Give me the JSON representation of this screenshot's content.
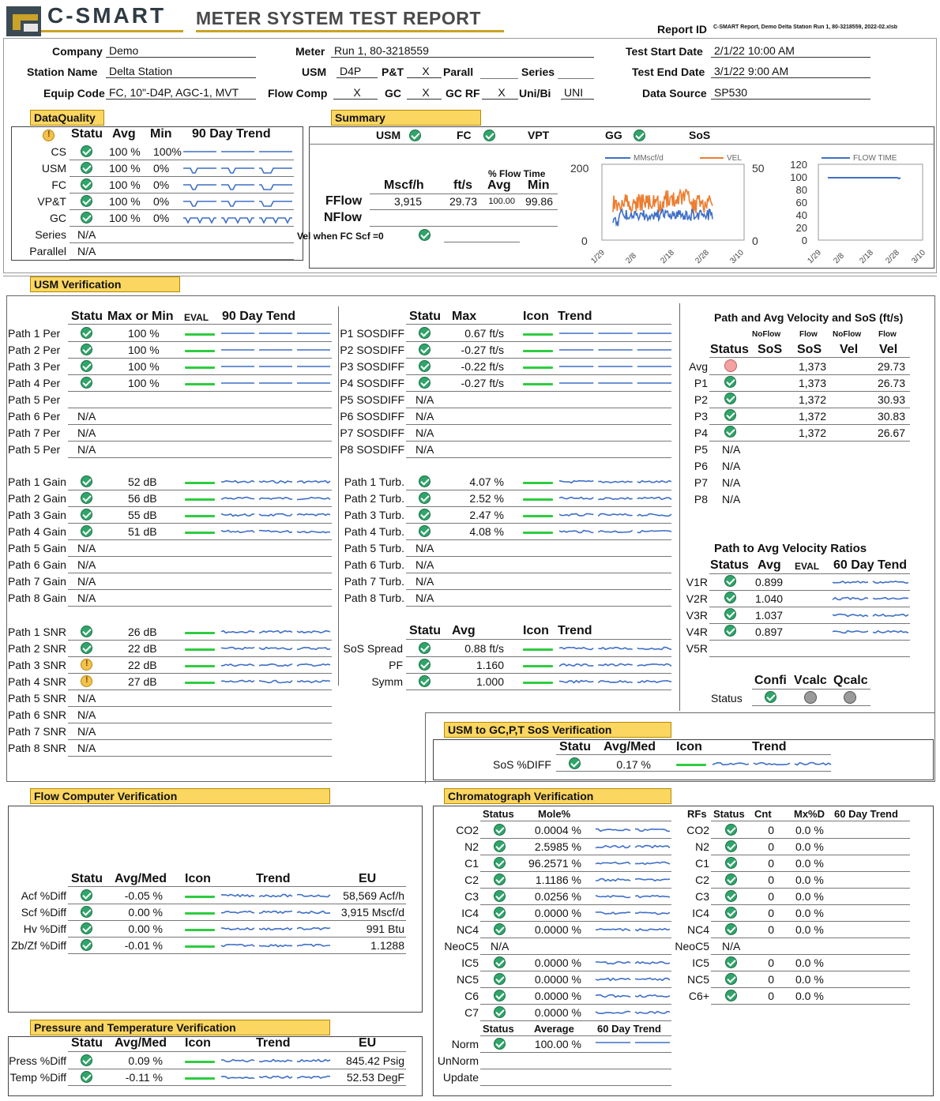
{
  "header": {
    "brand": "C-SMART",
    "title": "METER SYSTEM TEST REPORT",
    "report_id_label": "Report ID",
    "report_id_value": "C-SMART Report, Demo Delta Station Run 1, 80-3218559, 2022-02.xlsb"
  },
  "info": {
    "company_label": "Company",
    "company": "Demo",
    "station_label": "Station Name",
    "station": "Delta Station",
    "equip_label": "Equip Code",
    "equip": "FC, 10\"-D4P, AGC-1, MVT",
    "meter_label": "Meter",
    "meter": "Run 1, 80-3218559",
    "usm_label": "USM",
    "usm": "D4P",
    "pt_label": "P&T",
    "pt": "X",
    "parall_label": "Parall",
    "series_label": "Series",
    "flowcomp_label": "Flow Comp",
    "flowcomp": "X",
    "gc_label": "GC",
    "gc": "X",
    "gcrf_label": "GC RF",
    "gcrf": "X",
    "unibi_label": "Uni/Bi",
    "unibi": "UNI",
    "start_label": "Test Start Date",
    "start": "2/1/22 10:00 AM",
    "end_label": "Test End Date",
    "end": "3/1/22 9:00 AM",
    "source_label": "Data Source",
    "source": "SP530"
  },
  "dq": {
    "section": "DataQuality",
    "h_status": "Statu",
    "h_avg": "Avg",
    "h_min": "Min",
    "h_trend": "90 Day Trend",
    "rows": [
      {
        "label": "CS",
        "avg": "100 %",
        "min": "100%"
      },
      {
        "label": "USM",
        "avg": "100 %",
        "min": "0%"
      },
      {
        "label": "FC",
        "avg": "100 %",
        "min": "0%"
      },
      {
        "label": "VP&T",
        "avg": "100 %",
        "min": "0%"
      },
      {
        "label": "GC",
        "avg": "100 %",
        "min": "0%"
      },
      {
        "label": "Series",
        "avg": "N/A"
      },
      {
        "label": "Parallel",
        "avg": "N/A"
      }
    ]
  },
  "summary": {
    "section": "Summary",
    "items": [
      "USM",
      "FC",
      "VPT",
      "GG",
      "SoS"
    ],
    "h_mscfh": "Mscf/h",
    "h_fts": "ft/s",
    "h_pct_flow": "% Flow Time",
    "h_avg": "Avg",
    "h_min": "Min",
    "fflow_label": "FFlow",
    "fflow_mscfh": "3,915",
    "fflow_fts": "29.73",
    "fflow_avg": "100.00",
    "fflow_min": "99.86",
    "nflow_label": "NFlow",
    "vel_label": "Vel when FC Scf =0"
  },
  "chart1": {
    "legend_a": "MMscf/d",
    "legend_b": "VEL",
    "yleft_max": "200",
    "yleft_min": "0",
    "yright_max": "50",
    "yright_min": "0",
    "xticks": [
      "1/29",
      "2/8",
      "2/18",
      "2/28",
      "3/10"
    ],
    "color_a": "#3f6fc6",
    "color_b": "#ed7d31"
  },
  "chart2": {
    "legend": "FLOW TIME",
    "yticks": [
      "120",
      "100",
      "80",
      "60",
      "40",
      "20",
      "0"
    ],
    "xticks": [
      "1/29",
      "2/8",
      "2/18",
      "2/28",
      "3/10"
    ],
    "color": "#3f6fc6"
  },
  "usm": {
    "section": "USM Verification",
    "col1": {
      "h_status": "Statu",
      "h_max": "Max or Min",
      "h_eval": "EVAL",
      "h_trend": "90 Day Tend"
    },
    "per": [
      {
        "label": "Path 1 Per",
        "val": "100 %"
      },
      {
        "label": "Path 2 Per",
        "val": "100 %"
      },
      {
        "label": "Path 3 Per",
        "val": "100 %"
      },
      {
        "label": "Path 4 Per",
        "val": "100 %"
      },
      {
        "label": "Path 5 Per"
      },
      {
        "label": "Path 6 Per",
        "na": "N/A"
      },
      {
        "label": "Path 7 Per",
        "na": "N/A"
      },
      {
        "label": "Path 5 Per",
        "na": "N/A"
      }
    ],
    "gain": [
      {
        "label": "Path 1 Gain",
        "val": "52 dB"
      },
      {
        "label": "Path 2 Gain",
        "val": "56 dB"
      },
      {
        "label": "Path 3 Gain",
        "val": "55 dB"
      },
      {
        "label": "Path 4 Gain",
        "val": "51 dB"
      },
      {
        "label": "Path 5 Gain",
        "na": "N/A"
      },
      {
        "label": "Path 6 Gain",
        "na": "N/A"
      },
      {
        "label": "Path 7 Gain",
        "na": "N/A"
      },
      {
        "label": "Path 8 Gain",
        "na": "N/A"
      }
    ],
    "snr": [
      {
        "label": "Path 1 SNR",
        "val": "26 dB",
        "st": "ok"
      },
      {
        "label": "Path 2 SNR",
        "val": "22 dB",
        "st": "ok"
      },
      {
        "label": "Path 3 SNR",
        "val": "22 dB",
        "st": "warn"
      },
      {
        "label": "Path 4 SNR",
        "val": "27 dB",
        "st": "warn"
      },
      {
        "label": "Path 5 SNR",
        "na": "N/A"
      },
      {
        "label": "Path 6 SNR",
        "na": "N/A"
      },
      {
        "label": "Path 7 SNR",
        "na": "N/A"
      },
      {
        "label": "Path 8 SNR",
        "na": "N/A"
      }
    ],
    "col2": {
      "h_status": "Statu",
      "h_max": "Max",
      "h_icon": "Icon",
      "h_trend": "Trend"
    },
    "sos": [
      {
        "label": "P1 SOSDIFF",
        "val": "0.67 ft/s"
      },
      {
        "label": "P2 SOSDIFF",
        "val": "-0.27 ft/s"
      },
      {
        "label": "P3 SOSDIFF",
        "val": "-0.22 ft/s"
      },
      {
        "label": "P4 SOSDIFF",
        "val": "-0.27 ft/s"
      },
      {
        "label": "P5 SOSDIFF",
        "na": "N/A"
      },
      {
        "label": "P6 SOSDIFF",
        "na": "N/A"
      },
      {
        "label": "P7 SOSDIFF",
        "na": "N/A"
      },
      {
        "label": "P8 SOSDIFF",
        "na": "N/A"
      }
    ],
    "turb": [
      {
        "label": "Path 1 Turb.",
        "val": "4.07 %"
      },
      {
        "label": "Path 2 Turb.",
        "val": "2.52 %"
      },
      {
        "label": "Path 3 Turb.",
        "val": "2.47 %"
      },
      {
        "label": "Path 4 Turb.",
        "val": "4.08 %"
      },
      {
        "label": "Path 5 Turb.",
        "na": "N/A"
      },
      {
        "label": "Path 6 Turb.",
        "na": "N/A"
      },
      {
        "label": "Path 7 Turb.",
        "na": "N/A"
      },
      {
        "label": "Path 8 Turb.",
        "na": "N/A"
      }
    ],
    "col2b": {
      "h_status": "Statu",
      "h_avg": "Avg",
      "h_icon": "Icon",
      "h_trend": "Trend"
    },
    "misc": [
      {
        "label": "SoS Spread",
        "val": "0.88 ft/s"
      },
      {
        "label": "PF",
        "val": "1.160"
      },
      {
        "label": "Symm",
        "val": "1.000"
      }
    ]
  },
  "pathvel": {
    "title": "Path and Avg Velocity and SoS (ft/s)",
    "h_noflow1": "NoFlow",
    "h_flow1": "Flow",
    "h_noflow2": "NoFlow",
    "h_flow2": "Flow",
    "h_status": "Status",
    "h_sos1": "SoS",
    "h_sos2": "SoS",
    "h_vel1": "Vel",
    "h_vel2": "Vel",
    "rows": [
      {
        "label": "Avg",
        "st": "bad",
        "sos": "1,373",
        "vel": "29.73"
      },
      {
        "label": "P1",
        "st": "ok",
        "sos": "1,373",
        "vel": "26.73"
      },
      {
        "label": "P2",
        "st": "ok",
        "sos": "1,372",
        "vel": "30.93"
      },
      {
        "label": "P3",
        "st": "ok",
        "sos": "1,372",
        "vel": "30.83"
      },
      {
        "label": "P4",
        "st": "ok",
        "sos": "1,372",
        "vel": "26.67"
      },
      {
        "label": "P5",
        "na": "N/A"
      },
      {
        "label": "P6",
        "na": "N/A"
      },
      {
        "label": "P7",
        "na": "N/A"
      },
      {
        "label": "P8",
        "na": "N/A"
      }
    ]
  },
  "ratios": {
    "title": "Path to Avg Velocity Ratios",
    "h_status": "Status",
    "h_avg": "Avg",
    "h_eval": "EVAL",
    "h_trend": "60 Day Tend",
    "rows": [
      {
        "label": "V1R",
        "val": "0.899"
      },
      {
        "label": "V2R",
        "val": "1.040"
      },
      {
        "label": "V3R",
        "val": "1.037"
      },
      {
        "label": "V4R",
        "val": "0.897"
      },
      {
        "label": "V5R"
      }
    ]
  },
  "confi": {
    "h1": "Confi",
    "h2": "Vcalc",
    "h3": "Qcalc",
    "status_label": "Status"
  },
  "usmgc": {
    "section": "USM to GC,P,T SoS Verification",
    "h_status": "Statu",
    "h_avg": "Avg/Med",
    "h_icon": "Icon",
    "h_trend": "Trend",
    "label": "SoS %DIFF",
    "val": "0.17 %"
  },
  "fc": {
    "section": "Flow Computer Verification",
    "h_status": "Statu",
    "h_avg": "Avg/Med",
    "h_icon": "Icon",
    "h_trend": "Trend",
    "h_eu": "EU",
    "rows": [
      {
        "label": "Acf %Diff",
        "val": "-0.05 %",
        "eu": "58,569 Acf/h"
      },
      {
        "label": "Scf %Diff",
        "val": "0.00 %",
        "eu": "3,915 Mscf/d"
      },
      {
        "label": "Hv %Diff",
        "val": "0.00 %",
        "eu": "991 Btu"
      },
      {
        "label": "Zb/Zf %Diff",
        "val": "-0.01 %",
        "eu": "1.1288"
      }
    ]
  },
  "pt": {
    "section": "Pressure and Temperature Verification",
    "h_status": "Statu",
    "h_avg": "Avg/Med",
    "h_icon": "Icon",
    "h_trend": "Trend",
    "h_eu": "EU",
    "rows": [
      {
        "label": "Press %Diff",
        "val": "0.09 %",
        "eu": "845.42 Psig"
      },
      {
        "label": "Temp %Diff",
        "val": "-0.11 %",
        "eu": "52.53 DegF"
      }
    ]
  },
  "chrom": {
    "section": "Chromatograph Verification",
    "h_status": "Status",
    "h_mole": "Mole%",
    "h_rfs": "RFs",
    "h_status2": "Status",
    "h_cnt": "Cnt",
    "h_mxd": "Mx%D",
    "h_trend": "60 Day Trend",
    "rows": [
      {
        "label": "CO2",
        "mole": "0.0004 %",
        "rf": "CO2",
        "cnt": "0",
        "mx": "0.0 %"
      },
      {
        "label": "N2",
        "mole": "2.5985 %",
        "rf": "N2",
        "cnt": "0",
        "mx": "0.0 %"
      },
      {
        "label": "C1",
        "mole": "96.2571 %",
        "rf": "C1",
        "cnt": "0",
        "mx": "0.0 %"
      },
      {
        "label": "C2",
        "mole": "1.1186 %",
        "rf": "C2",
        "cnt": "0",
        "mx": "0.0 %"
      },
      {
        "label": "C3",
        "mole": "0.0256 %",
        "rf": "C3",
        "cnt": "0",
        "mx": "0.0 %"
      },
      {
        "label": "IC4",
        "mole": "0.0000 %",
        "rf": "IC4",
        "cnt": "0",
        "mx": "0.0 %"
      },
      {
        "label": "NC4",
        "mole": "0.0000 %",
        "rf": "NC4",
        "cnt": "0",
        "mx": "0.0 %"
      },
      {
        "label": "NeoC5",
        "na": "N/A",
        "rf": "NeoC5",
        "rfna": "N/A"
      },
      {
        "label": "IC5",
        "mole": "0.0000 %",
        "rf": "IC5",
        "cnt": "0",
        "mx": "0.0 %"
      },
      {
        "label": "NC5",
        "mole": "0.0000 %",
        "rf": "NC5",
        "cnt": "0",
        "mx": "0.0 %"
      },
      {
        "label": "C6",
        "mole": "0.0000 %",
        "rf": "C6+",
        "cnt": "0",
        "mx": "0.0 %"
      },
      {
        "label": "C7",
        "mole": "0.0000 %"
      }
    ],
    "h2_status": "Status",
    "h2_avg": "Average",
    "h2_trend": "60 Day Trend",
    "norm_rows": [
      {
        "label": "Norm",
        "val": "100.00 %"
      },
      {
        "label": "UnNorm"
      },
      {
        "label": "Update"
      }
    ]
  }
}
